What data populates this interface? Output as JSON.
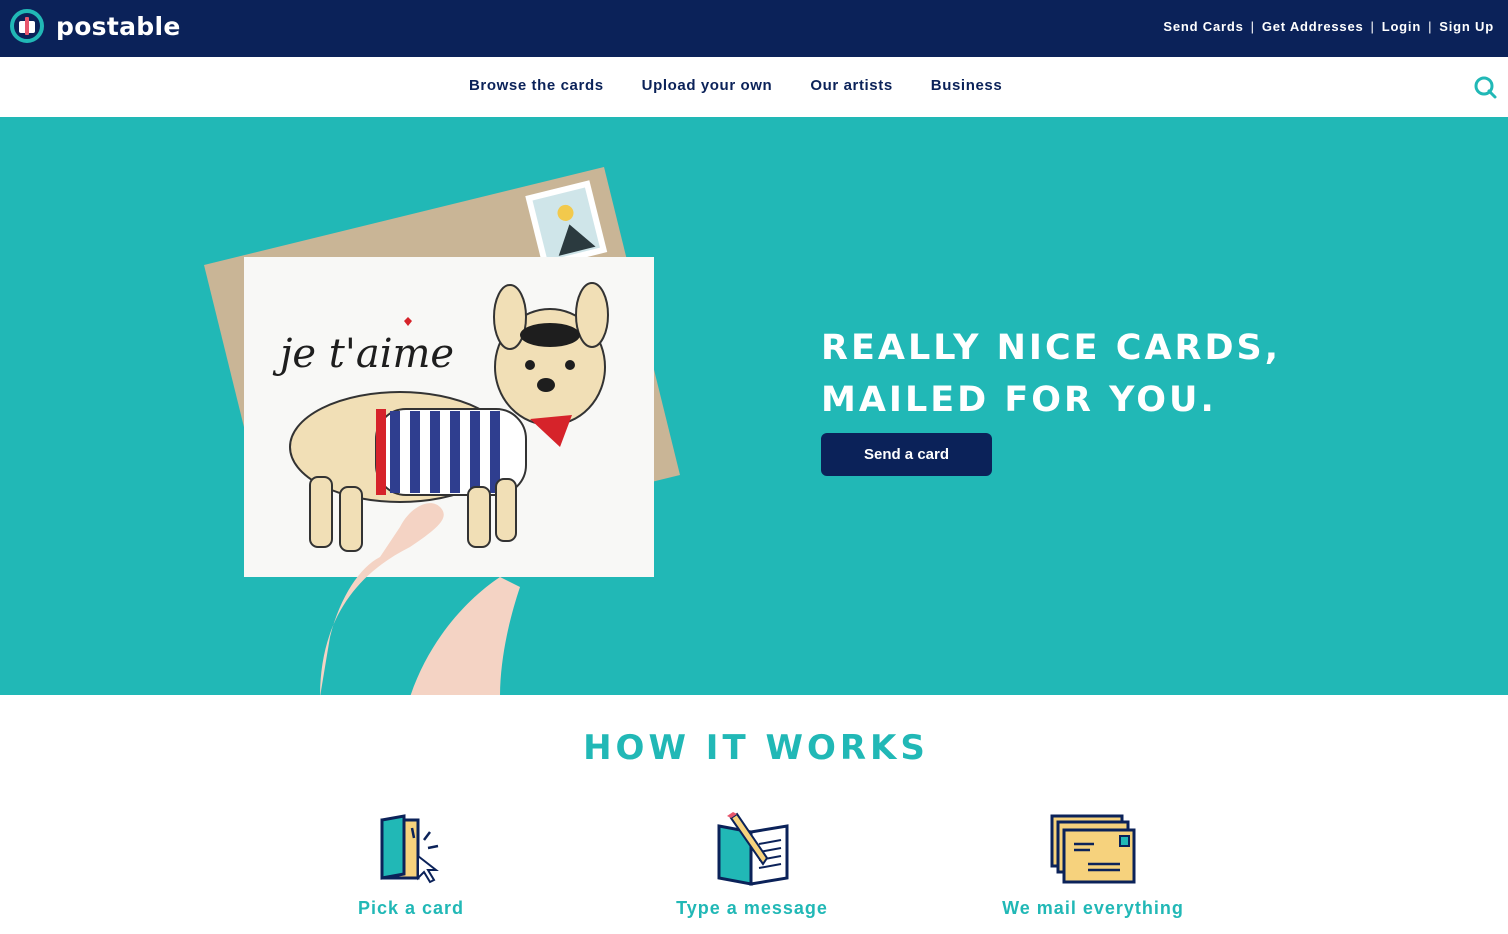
{
  "brand": {
    "name": "postable"
  },
  "top_links": [
    "Send Cards",
    "Get Addresses",
    "Login",
    "Sign Up"
  ],
  "nav": {
    "items": [
      "Browse the cards",
      "Upload your own",
      "Our artists",
      "Business"
    ],
    "search_icon": "search-icon"
  },
  "hero": {
    "heading_line1": "REALLY NICE CARDS,",
    "heading_line2": "MAILED FOR YOU.",
    "cta_label": "Send a card",
    "card_text": "je t'aime"
  },
  "how_it_works": {
    "title": "HOW IT WORKS",
    "steps": [
      {
        "label": "Pick a card",
        "icon": "card-pick-icon"
      },
      {
        "label": "Type a message",
        "icon": "write-message-icon"
      },
      {
        "label": "We mail everything",
        "icon": "mail-envelopes-icon"
      }
    ]
  },
  "colors": {
    "navy": "#0b2259",
    "teal": "#21b8b6",
    "white": "#ffffff"
  }
}
